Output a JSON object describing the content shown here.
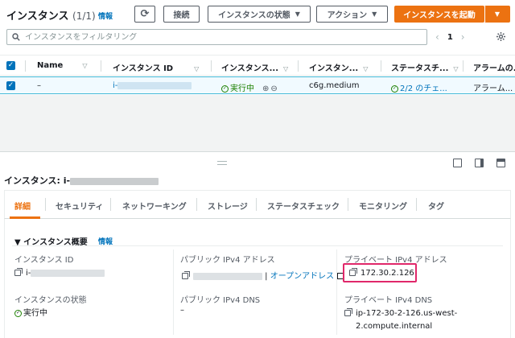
{
  "header": {
    "title": "インスタンス",
    "count": "(1/1)",
    "info": "情報",
    "refresh_icon": "⟳",
    "connect_label": "接続",
    "state_label": "インスタンスの状態",
    "action_label": "アクション",
    "launch_label": "インスタンスを起動",
    "caret": "▼"
  },
  "search": {
    "placeholder": "インスタンスをフィルタリング",
    "icon": "search-icon"
  },
  "pagination": {
    "prev": "‹",
    "page": "1",
    "next": "›"
  },
  "table": {
    "columns": [
      "Name",
      "インスタンス ID",
      "インスタンス...",
      "インスタン...",
      "ステータスチ...",
      "アラームの..."
    ],
    "sort_icon": "▽",
    "row": {
      "name": "–",
      "instance_id_prefix": "i-",
      "state": "実行中",
      "instance_type": "c6g.medium",
      "status_check": "2/2 のチェ...",
      "alarm": "アラーム..."
    }
  },
  "panel": {
    "title": "インスタンス: i-",
    "tabs": [
      "詳細",
      "セキュリティ",
      "ネットワーキング",
      "ストレージ",
      "ステータスチェック",
      "モニタリング",
      "タグ"
    ],
    "summary_title": "▼ インスタンス概要",
    "summary_info": "情報",
    "fields": {
      "instance_id_label": "インスタンス ID",
      "instance_id_value": "i-",
      "public_ipv4_label": "パブリック IPv4 アドレス",
      "open_address": "オープンアドレス",
      "private_ipv4_label": "プライベート IPv4 アドレス",
      "private_ipv4_value": "172.30.2.126",
      "state_label": "インスタンスの状態",
      "state_value": "実行中",
      "public_dns_label": "パブリック IPv4 DNS",
      "public_dns_value": "–",
      "private_dns_label": "プライベート IPv4 DNS",
      "private_dns_line1": "ip-172-30-2-126.us-west-",
      "private_dns_line2": "2.compute.internal"
    }
  },
  "colors": {
    "accent_orange": "#ec7211",
    "link_blue": "#0073bb",
    "success_green": "#1d8102",
    "highlight_pink": "#e0286a"
  }
}
